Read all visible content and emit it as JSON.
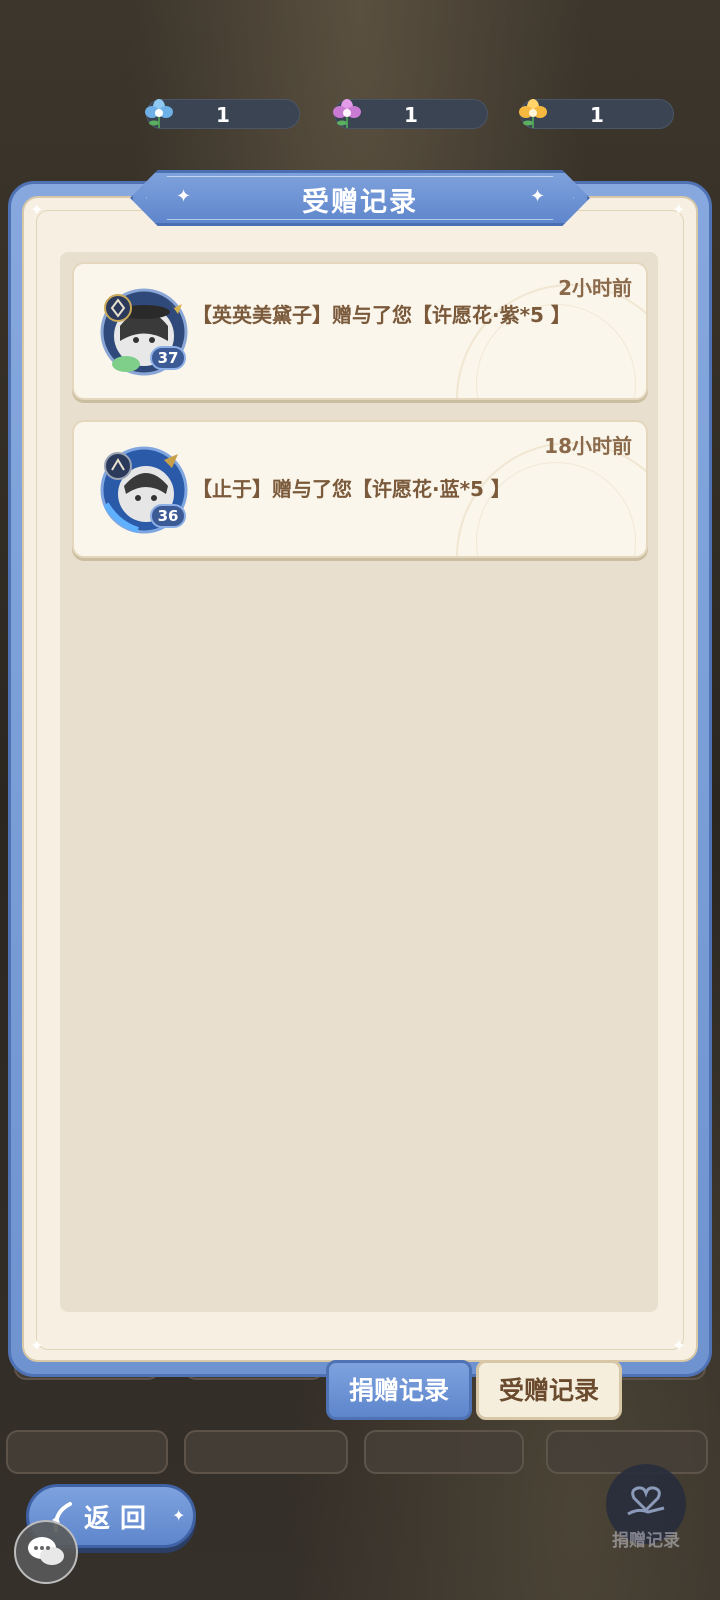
{
  "currency": [
    {
      "icon": "blue-flower-icon",
      "value": "1"
    },
    {
      "icon": "purple-flower-icon",
      "value": "1"
    },
    {
      "icon": "gold-flower-icon",
      "value": "1"
    }
  ],
  "panel": {
    "title": "受赠记录"
  },
  "records": [
    {
      "time": "2小时前",
      "message": "【英英美黛子】赠与了您【许愿花·紫*5 】",
      "level": "37"
    },
    {
      "time": "18小时前",
      "message": "【止于】赠与了您【许愿花·蓝*5 】",
      "level": "36"
    }
  ],
  "tabs": {
    "donate_label": "捐赠记录",
    "received_label": "受赠记录"
  },
  "buttons": {
    "back_label": "返回",
    "donate_record_label": "捐赠记录"
  },
  "colors": {
    "accent_blue": "#6f93d0",
    "panel_cream": "#f7f0e2",
    "text_brown": "#7a5a3a"
  }
}
